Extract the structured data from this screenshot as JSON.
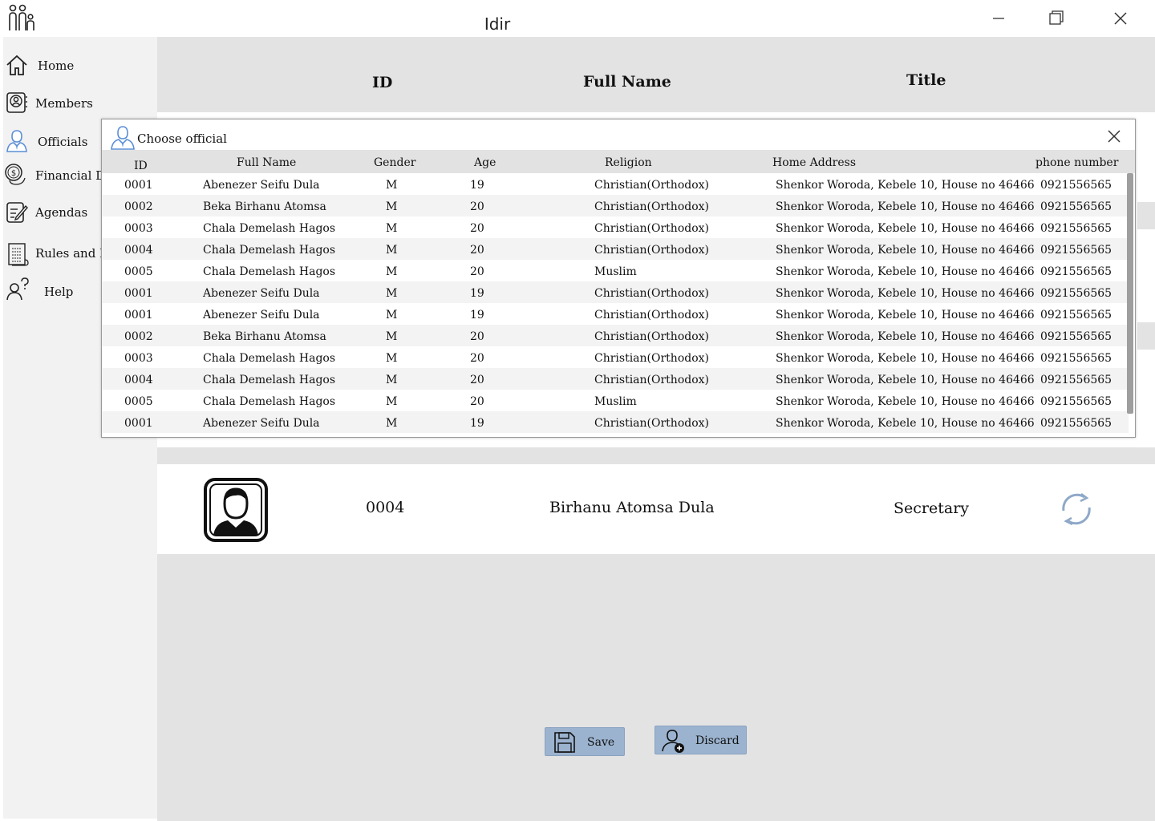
{
  "app": {
    "title": "Idir"
  },
  "sidebar": {
    "items": [
      {
        "label": "Home",
        "icon": "home-icon"
      },
      {
        "label": "Members",
        "icon": "members-icon"
      },
      {
        "label": "Officials",
        "icon": "official-icon"
      },
      {
        "label": "Financial Da",
        "icon": "coins-icon"
      },
      {
        "label": "Agendas",
        "icon": "agenda-icon"
      },
      {
        "label": "Rules and R",
        "icon": "rules-icon"
      },
      {
        "label": "Help",
        "icon": "help-icon"
      }
    ]
  },
  "main": {
    "columns": {
      "id": "ID",
      "full_name": "Full Name",
      "title": "Title"
    },
    "selected": {
      "id": "0004",
      "full_name": "Birhanu Atomsa Dula",
      "title": "Secretary"
    },
    "buttons": {
      "save": "Save",
      "discard": "Discard"
    }
  },
  "dialog": {
    "title": "Choose official",
    "headers": [
      "ID",
      "Full Name",
      "Gender",
      "Age",
      "Religion",
      "Home Address",
      "phone number"
    ],
    "rows": [
      [
        "0001",
        "Abenezer Seifu Dula",
        "M",
        "19",
        "Christian(Orthodox)",
        "Shenkor Woroda, Kebele 10, House no 46466",
        "0921556565"
      ],
      [
        "0002",
        "Beka Birhanu Atomsa",
        "M",
        "20",
        "Christian(Orthodox)",
        "Shenkor Woroda, Kebele 10, House no 46466",
        "0921556565"
      ],
      [
        "0003",
        "Chala Demelash Hagos",
        "M",
        "20",
        "Christian(Orthodox)",
        "Shenkor Woroda, Kebele 10, House no 46466",
        "0921556565"
      ],
      [
        "0004",
        "Chala Demelash Hagos",
        "M",
        "20",
        "Christian(Orthodox)",
        "Shenkor Woroda, Kebele 10, House no 46466",
        "0921556565"
      ],
      [
        "0005",
        "Chala Demelash Hagos",
        "M",
        "20",
        "Muslim",
        "Shenkor Woroda, Kebele 10, House no 46466",
        "0921556565"
      ],
      [
        "0001",
        "Abenezer Seifu Dula",
        "M",
        "19",
        "Christian(Orthodox)",
        "Shenkor Woroda, Kebele 10, House no 46466",
        "0921556565"
      ],
      [
        "0001",
        "Abenezer Seifu Dula",
        "M",
        "19",
        "Christian(Orthodox)",
        "Shenkor Woroda, Kebele 10, House no 46466",
        "0921556565"
      ],
      [
        "0002",
        "Beka Birhanu Atomsa",
        "M",
        "20",
        "Christian(Orthodox)",
        "Shenkor Woroda, Kebele 10, House no 46466",
        "0921556565"
      ],
      [
        "0003",
        "Chala Demelash Hagos",
        "M",
        "20",
        "Christian(Orthodox)",
        "Shenkor Woroda, Kebele 10, House no 46466",
        "0921556565"
      ],
      [
        "0004",
        "Chala Demelash Hagos",
        "M",
        "20",
        "Christian(Orthodox)",
        "Shenkor Woroda, Kebele 10, House no 46466",
        "0921556565"
      ],
      [
        "0005",
        "Chala Demelash Hagos",
        "M",
        "20",
        "Muslim",
        "Shenkor Woroda, Kebele 10, House no 46466",
        "0921556565"
      ],
      [
        "0001",
        "Abenezer Seifu Dula",
        "M",
        "19",
        "Christian(Orthodox)",
        "Shenkor Woroda, Kebele 10, House no 46466",
        "0921556565"
      ]
    ]
  },
  "colors": {
    "accent": "#9bb3cf",
    "accent_icon": "#5b8ed6",
    "main_bg": "#e3e3e3",
    "sidebar_bg": "#f2f2f2"
  }
}
